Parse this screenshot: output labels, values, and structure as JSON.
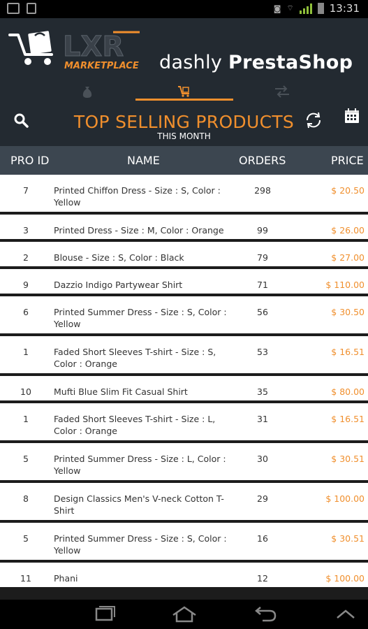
{
  "status_bar": {
    "time": "13:31",
    "left_icons": [
      "image-icon",
      "document-icon"
    ],
    "right_icons": [
      "nfc-icon",
      "wifi-icon",
      "signal-icon",
      "battery-icon"
    ]
  },
  "header": {
    "logo_text": "LXR",
    "logo_subtext": "MARKETPLACE",
    "brand_part1": "dashly",
    "brand_part2": "PrestaShop"
  },
  "tabs": [
    {
      "icon": "money-bag-icon",
      "active": false
    },
    {
      "icon": "cart-icon",
      "active": true
    },
    {
      "icon": "transfer-icon",
      "active": false
    }
  ],
  "title_bar": {
    "title": "TOP SELLING PRODUCTS",
    "subtitle": "THIS MONTH"
  },
  "table": {
    "columns": [
      "PRO ID",
      "NAME",
      "ORDERS",
      "PRICE"
    ],
    "rows": [
      {
        "id": "7",
        "name": "Printed Chiffon Dress - Size : S, Color : Yellow",
        "orders": "298",
        "price": "$ 20.50"
      },
      {
        "id": "3",
        "name": "Printed Dress - Size : M, Color : Orange",
        "orders": "99",
        "price": "$ 26.00"
      },
      {
        "id": "2",
        "name": "Blouse - Size : S, Color : Black",
        "orders": "79",
        "price": "$ 27.00"
      },
      {
        "id": "9",
        "name": "Dazzio Indigo Partywear Shirt",
        "orders": "71",
        "price": "$ 110.00"
      },
      {
        "id": "6",
        "name": "Printed Summer Dress - Size : S, Color : Yellow",
        "orders": "56",
        "price": "$ 30.50"
      },
      {
        "id": "1",
        "name": "Faded Short Sleeves T-shirt - Size : S, Color : Orange",
        "orders": "53",
        "price": "$ 16.51"
      },
      {
        "id": "10",
        "name": "Mufti Blue Slim Fit Casual Shirt",
        "orders": "35",
        "price": "$ 80.00"
      },
      {
        "id": "1",
        "name": "Faded Short Sleeves T-shirt - Size : L, Color : Orange",
        "orders": "31",
        "price": "$ 16.51"
      },
      {
        "id": "5",
        "name": "Printed Summer Dress - Size : L, Color : Yellow",
        "orders": "30",
        "price": "$ 30.51"
      },
      {
        "id": "8",
        "name": "Design Classics Men's V-neck Cotton T-Shirt",
        "orders": "29",
        "price": "$ 100.00"
      },
      {
        "id": "5",
        "name": "Printed Summer Dress - Size : S, Color : Yellow",
        "orders": "16",
        "price": "$ 30.51"
      },
      {
        "id": "11",
        "name": "Phani",
        "orders": "12",
        "price": "$ 100.00"
      }
    ]
  },
  "colors": {
    "accent": "#f08f2d",
    "header_bg": "#232a31",
    "table_header_bg": "#3c4650"
  }
}
